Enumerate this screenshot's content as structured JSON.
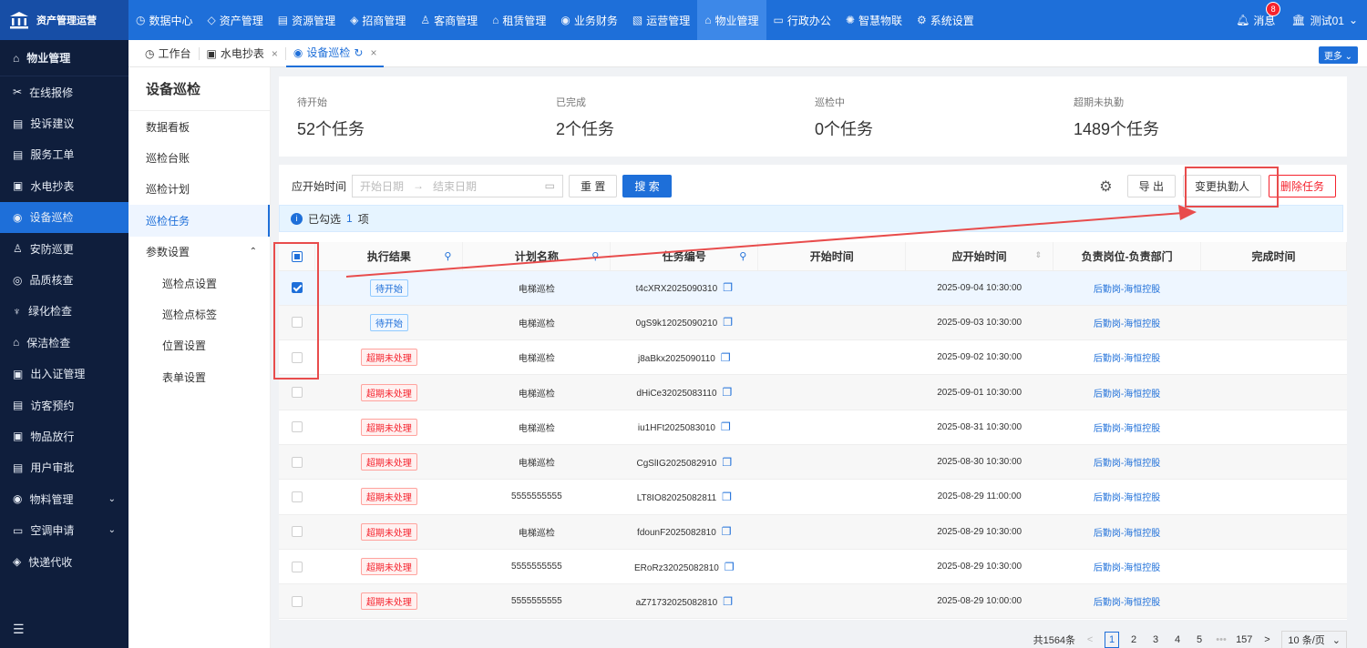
{
  "topbar": {
    "brand": "资产管理运营",
    "nav": [
      {
        "label": "数据中心",
        "icon": "dashboard-icon",
        "glyph": "◷",
        "active": false
      },
      {
        "label": "资产管理",
        "icon": "cube-icon",
        "glyph": "◇",
        "active": false
      },
      {
        "label": "资源管理",
        "icon": "chart-icon",
        "glyph": "▤",
        "active": false
      },
      {
        "label": "招商管理",
        "icon": "tag-icon",
        "glyph": "◈",
        "active": false
      },
      {
        "label": "客商管理",
        "icon": "people-icon",
        "glyph": "♙",
        "active": false
      },
      {
        "label": "租赁管理",
        "icon": "house-icon",
        "glyph": "⌂",
        "active": false
      },
      {
        "label": "业务财务",
        "icon": "coin-icon",
        "glyph": "◉",
        "active": false
      },
      {
        "label": "运营管理",
        "icon": "chart-line-icon",
        "glyph": "▧",
        "active": false
      },
      {
        "label": "物业管理",
        "icon": "home-icon",
        "glyph": "⌂",
        "active": true
      },
      {
        "label": "行政办公",
        "icon": "monitor-icon",
        "glyph": "▭",
        "active": false
      },
      {
        "label": "智慧物联",
        "icon": "iot-icon",
        "glyph": "✺",
        "active": false
      },
      {
        "label": "系统设置",
        "icon": "gear-icon",
        "glyph": "⚙",
        "active": false
      }
    ],
    "messages": "消息",
    "message_count": "8",
    "user": "测试01"
  },
  "sidebar": {
    "header": "物业管理",
    "items": [
      {
        "label": "在线报修",
        "icon": "repair-icon",
        "glyph": "✂",
        "active": false,
        "chev": false
      },
      {
        "label": "投诉建议",
        "icon": "complaint-icon",
        "glyph": "▤",
        "active": false,
        "chev": false
      },
      {
        "label": "服务工单",
        "icon": "workorder-icon",
        "glyph": "▤",
        "active": false,
        "chev": false
      },
      {
        "label": "水电抄表",
        "icon": "meter-icon",
        "glyph": "▣",
        "active": false,
        "chev": false
      },
      {
        "label": "设备巡检",
        "icon": "inspect-icon",
        "glyph": "◉",
        "active": true,
        "chev": false
      },
      {
        "label": "安防巡更",
        "icon": "patrol-icon",
        "glyph": "♙",
        "active": false,
        "chev": false
      },
      {
        "label": "品质核查",
        "icon": "quality-icon",
        "glyph": "◎",
        "active": false,
        "chev": false
      },
      {
        "label": "绿化检查",
        "icon": "plant-icon",
        "glyph": "♆",
        "active": false,
        "chev": false
      },
      {
        "label": "保洁检查",
        "icon": "clean-icon",
        "glyph": "⌂",
        "active": false,
        "chev": false
      },
      {
        "label": "出入证管理",
        "icon": "pass-icon",
        "glyph": "▣",
        "active": false,
        "chev": false
      },
      {
        "label": "访客预约",
        "icon": "visitor-icon",
        "glyph": "▤",
        "active": false,
        "chev": false
      },
      {
        "label": "物品放行",
        "icon": "goods-icon",
        "glyph": "▣",
        "active": false,
        "chev": false
      },
      {
        "label": "用户审批",
        "icon": "approve-icon",
        "glyph": "▤",
        "active": false,
        "chev": false
      },
      {
        "label": "物料管理",
        "icon": "material-icon",
        "glyph": "◉",
        "active": false,
        "chev": true
      },
      {
        "label": "空调申请",
        "icon": "aircon-icon",
        "glyph": "▭",
        "active": false,
        "chev": true
      },
      {
        "label": "快递代收",
        "icon": "express-icon",
        "glyph": "◈",
        "active": false,
        "chev": false
      }
    ]
  },
  "tabs": [
    {
      "label": "工作台",
      "icon": "workbench-icon",
      "glyph": "◷",
      "active": false,
      "close": false
    },
    {
      "label": "水电抄表",
      "icon": "meter-tab-icon",
      "glyph": "▣",
      "active": false,
      "close": true
    },
    {
      "label": "设备巡检",
      "icon": "inspect-tab-icon",
      "glyph": "◉",
      "active": true,
      "close": true
    }
  ],
  "more_label": "更多",
  "subside": {
    "title": "设备巡检",
    "items": [
      {
        "label": "数据看板",
        "active": false,
        "child": false,
        "chev": false
      },
      {
        "label": "巡检台账",
        "active": false,
        "child": false,
        "chev": false
      },
      {
        "label": "巡检计划",
        "active": false,
        "child": false,
        "chev": false
      },
      {
        "label": "巡检任务",
        "active": true,
        "child": false,
        "chev": false
      },
      {
        "label": "参数设置",
        "active": false,
        "child": false,
        "chev": true
      },
      {
        "label": "巡检点设置",
        "active": false,
        "child": true,
        "chev": false
      },
      {
        "label": "巡检点标签",
        "active": false,
        "child": true,
        "chev": false
      },
      {
        "label": "位置设置",
        "active": false,
        "child": true,
        "chev": false
      },
      {
        "label": "表单设置",
        "active": false,
        "child": true,
        "chev": false
      }
    ]
  },
  "stats": [
    {
      "label": "待开始",
      "value": "52个任务"
    },
    {
      "label": "已完成",
      "value": "2个任务"
    },
    {
      "label": "巡检中",
      "value": "0个任务"
    },
    {
      "label": "超期未执勤",
      "value": "1489个任务"
    }
  ],
  "filter": {
    "label": "应开始时间",
    "start_placeholder": "开始日期",
    "arrow": "→",
    "end_placeholder": "结束日期",
    "reset": "重 置",
    "search": "搜 索",
    "export": "导 出",
    "change": "变更执勤人",
    "delete": "删除任务"
  },
  "selection": {
    "prefix": "已勾选",
    "count": "1",
    "suffix": "项"
  },
  "table": {
    "headers": [
      "执行结果",
      "计划名称",
      "任务编号",
      "开始时间",
      "应开始时间",
      "负责岗位-负责部门",
      "完成时间"
    ],
    "rows": [
      {
        "checked": true,
        "status": "待开始",
        "status_type": "blue",
        "plan": "电梯巡检",
        "code": "t4cXRX2025090310",
        "start": "",
        "due": "2025-09-04 10:30:00",
        "dept": "后勤岗-海恒控股",
        "done": ""
      },
      {
        "checked": false,
        "status": "待开始",
        "status_type": "blue",
        "plan": "电梯巡检",
        "code": "0gS9k12025090210",
        "start": "",
        "due": "2025-09-03 10:30:00",
        "dept": "后勤岗-海恒控股",
        "done": ""
      },
      {
        "checked": false,
        "status": "超期未处理",
        "status_type": "red",
        "plan": "电梯巡检",
        "code": "j8aBkx2025090110",
        "start": "",
        "due": "2025-09-02 10:30:00",
        "dept": "后勤岗-海恒控股",
        "done": ""
      },
      {
        "checked": false,
        "status": "超期未处理",
        "status_type": "red",
        "plan": "电梯巡检",
        "code": "dHiCe32025083110",
        "start": "",
        "due": "2025-09-01 10:30:00",
        "dept": "后勤岗-海恒控股",
        "done": ""
      },
      {
        "checked": false,
        "status": "超期未处理",
        "status_type": "red",
        "plan": "电梯巡检",
        "code": "iu1HFt2025083010",
        "start": "",
        "due": "2025-08-31 10:30:00",
        "dept": "后勤岗-海恒控股",
        "done": ""
      },
      {
        "checked": false,
        "status": "超期未处理",
        "status_type": "red",
        "plan": "电梯巡检",
        "code": "CgSlIG2025082910",
        "start": "",
        "due": "2025-08-30 10:30:00",
        "dept": "后勤岗-海恒控股",
        "done": ""
      },
      {
        "checked": false,
        "status": "超期未处理",
        "status_type": "red",
        "plan": "5555555555",
        "code": "LT8IO82025082811",
        "start": "",
        "due": "2025-08-29 11:00:00",
        "dept": "后勤岗-海恒控股",
        "done": ""
      },
      {
        "checked": false,
        "status": "超期未处理",
        "status_type": "red",
        "plan": "电梯巡检",
        "code": "fdounF2025082810",
        "start": "",
        "due": "2025-08-29 10:30:00",
        "dept": "后勤岗-海恒控股",
        "done": ""
      },
      {
        "checked": false,
        "status": "超期未处理",
        "status_type": "red",
        "plan": "5555555555",
        "code": "ERoRz32025082810",
        "start": "",
        "due": "2025-08-29 10:30:00",
        "dept": "后勤岗-海恒控股",
        "done": ""
      },
      {
        "checked": false,
        "status": "超期未处理",
        "status_type": "red",
        "plan": "5555555555",
        "code": "aZ71732025082810",
        "start": "",
        "due": "2025-08-29 10:00:00",
        "dept": "后勤岗-海恒控股",
        "done": ""
      }
    ]
  },
  "pager": {
    "total": "共1564条",
    "prev": "<",
    "pages": [
      "1",
      "2",
      "3",
      "4",
      "5"
    ],
    "current": "1",
    "ellipsis": "•••",
    "last": "157",
    "next": ">",
    "size": "10 条/页"
  },
  "colors": {
    "primary": "#1e6fd9",
    "danger": "#f5222d",
    "annotation": "#e84c4c",
    "sidebar_bg": "#0f1e3c"
  }
}
